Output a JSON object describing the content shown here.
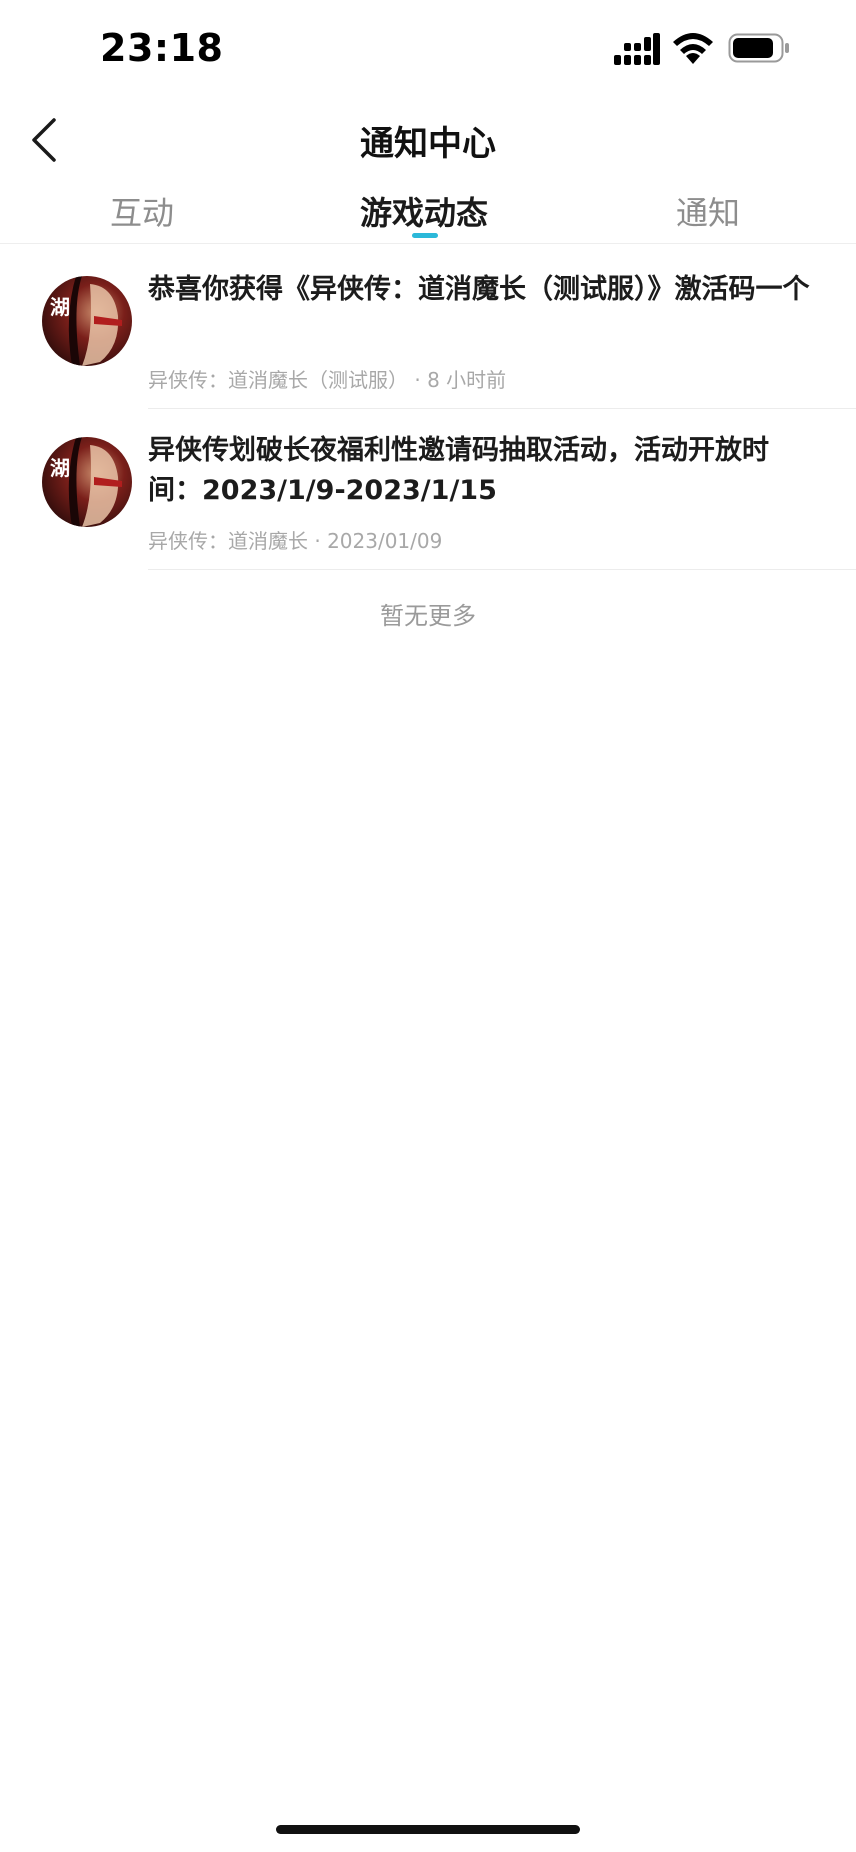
{
  "status_bar": {
    "time": "23:18",
    "icons": [
      "cellular-signal-icon",
      "wifi-icon",
      "battery-icon"
    ]
  },
  "header": {
    "back_icon": "chevron-left-icon",
    "title": "通知中心"
  },
  "tabs": [
    {
      "label": "互动",
      "active": false
    },
    {
      "label": "游戏动态",
      "active": true
    },
    {
      "label": "通知",
      "active": false
    }
  ],
  "colors": {
    "accent": "#2bb8d9",
    "text_primary": "#1c1c1c",
    "text_secondary": "#a8a8a8",
    "tab_inactive": "#8d8d8d"
  },
  "notices": [
    {
      "title": "恭喜你获得《异侠传：道消魔长（测试服）》激活码一个",
      "source": "异侠传：道消魔长（测试服）",
      "time": "· 8 小时前",
      "avatar_icon": "game-avatar-icon"
    },
    {
      "title": "异侠传划破长夜福利性邀请码抽取活动，活动开放时间：2023/1/9-2023/1/15",
      "source": "异侠传：道消魔长",
      "time": "· 2023/01/09",
      "avatar_icon": "game-avatar-icon"
    }
  ],
  "footer": {
    "no_more": "暂无更多"
  }
}
